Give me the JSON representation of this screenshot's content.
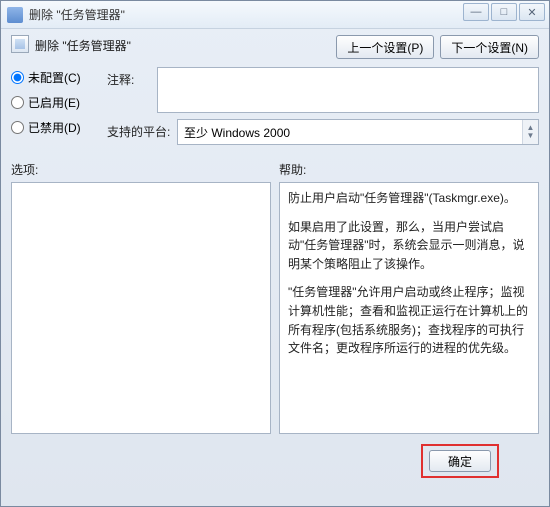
{
  "window": {
    "title": "删除 \"任务管理器\""
  },
  "win_controls": {
    "minimize": "—",
    "maximize": "□",
    "close": "✕"
  },
  "header": {
    "title": "删除 \"任务管理器\""
  },
  "nav": {
    "prev": "上一个设置(P)",
    "next": "下一个设置(N)"
  },
  "radios": {
    "not_configured": "未配置(C)",
    "enabled": "已启用(E)",
    "disabled": "已禁用(D)",
    "selected": "not_configured"
  },
  "fields": {
    "comment_label": "注释:",
    "comment_value": "",
    "platform_label": "支持的平台:",
    "platform_value": "至少 Windows 2000"
  },
  "panes": {
    "options_label": "选项:",
    "help_label": "帮助:",
    "help_paragraphs": [
      "防止用户启动\"任务管理器\"(Taskmgr.exe)。",
      "如果启用了此设置，那么，当用户尝试启动\"任务管理器\"时，系统会显示一则消息，说明某个策略阻止了该操作。",
      "\"任务管理器\"允许用户启动或终止程序；监视计算机性能；查看和监视正运行在计算机上的所有程序(包括系统服务)；查找程序的可执行文件名；更改程序所运行的进程的优先级。"
    ]
  },
  "footer": {
    "ok": "确定"
  }
}
